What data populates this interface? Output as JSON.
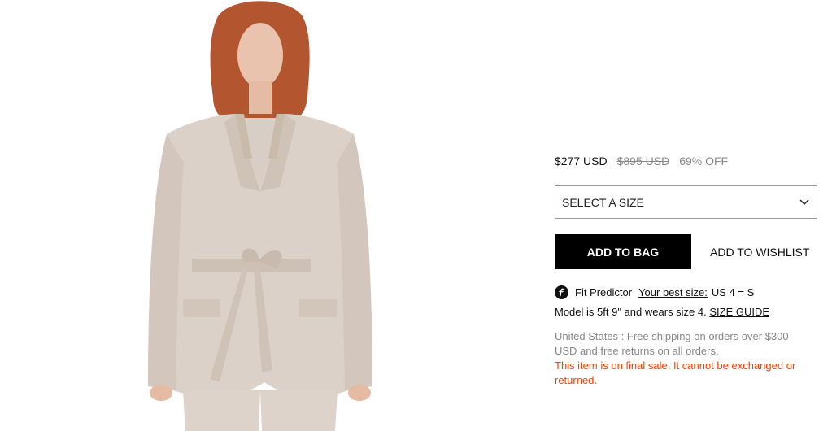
{
  "product": {
    "image_alt": "Beige belted collarless blazer worn by model",
    "price": {
      "current": "$277 USD",
      "original": "$895 USD",
      "discount": "69% OFF"
    },
    "size_select": {
      "placeholder": "SELECT A SIZE",
      "icon": "chevron-down-icon"
    },
    "buttons": {
      "add_to_bag": "ADD TO BAG",
      "add_to_wishlist": "ADD TO WISHLIST"
    },
    "fit_predictor": {
      "icon": "fit-predictor-icon",
      "label": "Fit Predictor",
      "link": "Your best size:",
      "value": "US 4 = S"
    },
    "model_info": {
      "text": "Model is 5ft 9\" and wears size 4.",
      "size_guide": "SIZE GUIDE"
    },
    "shipping_text": "United States : Free shipping on orders over $300 USD and free returns on all orders.",
    "final_sale_text": "This item is on final sale. It cannot be exchanged or returned.",
    "colors": {
      "final_sale": "#ff3c00",
      "muted": "#888888",
      "primary_button": "#000000"
    }
  }
}
